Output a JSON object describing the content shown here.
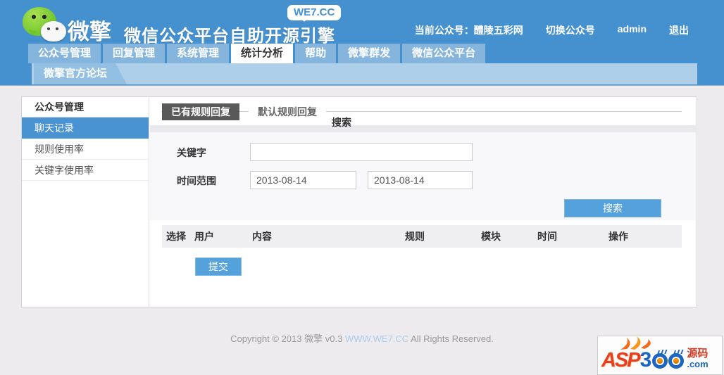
{
  "colors": {
    "header_blue": "#4590cf",
    "nav_tab_blue": "#85b5dc",
    "nav_bar2_blue": "#aecfe9",
    "accent_button_blue": "#55a1dc",
    "sidebar_active_blue": "#4a93d3",
    "content_tab_dark": "#595959"
  },
  "header": {
    "logo_title": "微擎",
    "logo_subtitle": "微信公众平台自助开源引擎",
    "badge": "WE7.CC",
    "current_account_label": "当前公众号：",
    "current_account_name": "醴陵五彩网",
    "switch_account": "切换公众号",
    "username": "admin",
    "logout": "退出"
  },
  "nav": {
    "tabs": [
      {
        "label": "公众号管理",
        "active": false
      },
      {
        "label": "回复管理",
        "active": false
      },
      {
        "label": "系统管理",
        "active": false
      },
      {
        "label": "统计分析",
        "active": true
      },
      {
        "label": "帮助",
        "active": false
      },
      {
        "label": "微擎群发",
        "active": false
      },
      {
        "label": "微信公众平台",
        "active": false
      }
    ],
    "forum_tab": "微擎官方论坛"
  },
  "sidebar": {
    "title": "公众号管理",
    "items": [
      {
        "label": "聊天记录",
        "active": true
      },
      {
        "label": "规则使用率",
        "active": false
      },
      {
        "label": "关键字使用率",
        "active": false
      }
    ]
  },
  "content": {
    "tabs": [
      {
        "label": "已有规则回复",
        "active": true
      },
      {
        "label": "默认规则回复",
        "active": false
      }
    ],
    "search": {
      "title": "搜索",
      "keyword_label": "关键字",
      "keyword_value": "",
      "range_label": "时间范围",
      "date_from": "2013-08-14",
      "date_to": "2013-08-14",
      "search_button": "搜索"
    },
    "table": {
      "columns": [
        "选择",
        "用户",
        "内容",
        "规则",
        "模块",
        "时间",
        "操作"
      ]
    },
    "submit_button": "提交"
  },
  "footer": {
    "prefix": "Copyright © 2013 微擎 v0.3 ",
    "link": "WWW.WE7.CC",
    "suffix": " All Rights Reserved."
  },
  "watermark": {
    "asp": "ASP",
    "number": "300",
    "three": "3",
    "cn": "源码",
    "com": ".com"
  }
}
